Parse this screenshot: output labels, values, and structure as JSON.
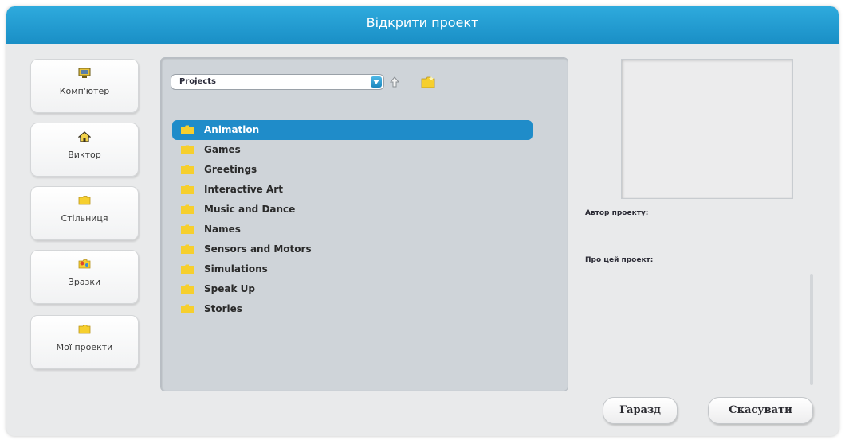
{
  "dialog": {
    "title": "Відкрити проект"
  },
  "sidebar": {
    "items": [
      {
        "label": "Комп'ютер",
        "icon": "computer-icon"
      },
      {
        "label": "Виктор",
        "icon": "home-icon"
      },
      {
        "label": "Стільниця",
        "icon": "folder-icon"
      },
      {
        "label": "Зразки",
        "icon": "samples-icon"
      },
      {
        "label": "Мої проекти",
        "icon": "folder-icon"
      }
    ]
  },
  "browser": {
    "path": "Projects",
    "items": [
      {
        "name": "Animation",
        "selected": true
      },
      {
        "name": "Games"
      },
      {
        "name": "Greetings"
      },
      {
        "name": "Interactive Art"
      },
      {
        "name": "Music and Dance"
      },
      {
        "name": "Names"
      },
      {
        "name": "Sensors and Motors"
      },
      {
        "name": "Simulations"
      },
      {
        "name": "Speak Up"
      },
      {
        "name": "Stories"
      }
    ]
  },
  "info": {
    "author_label": "Автор проекту:",
    "about_label": "Про цей проект:"
  },
  "buttons": {
    "ok": "Гаразд",
    "cancel": "Скасувати"
  },
  "colors": {
    "title_bar": "#1f9ad2",
    "selection": "#1f8cc9",
    "folder": "#f6cf2e"
  }
}
